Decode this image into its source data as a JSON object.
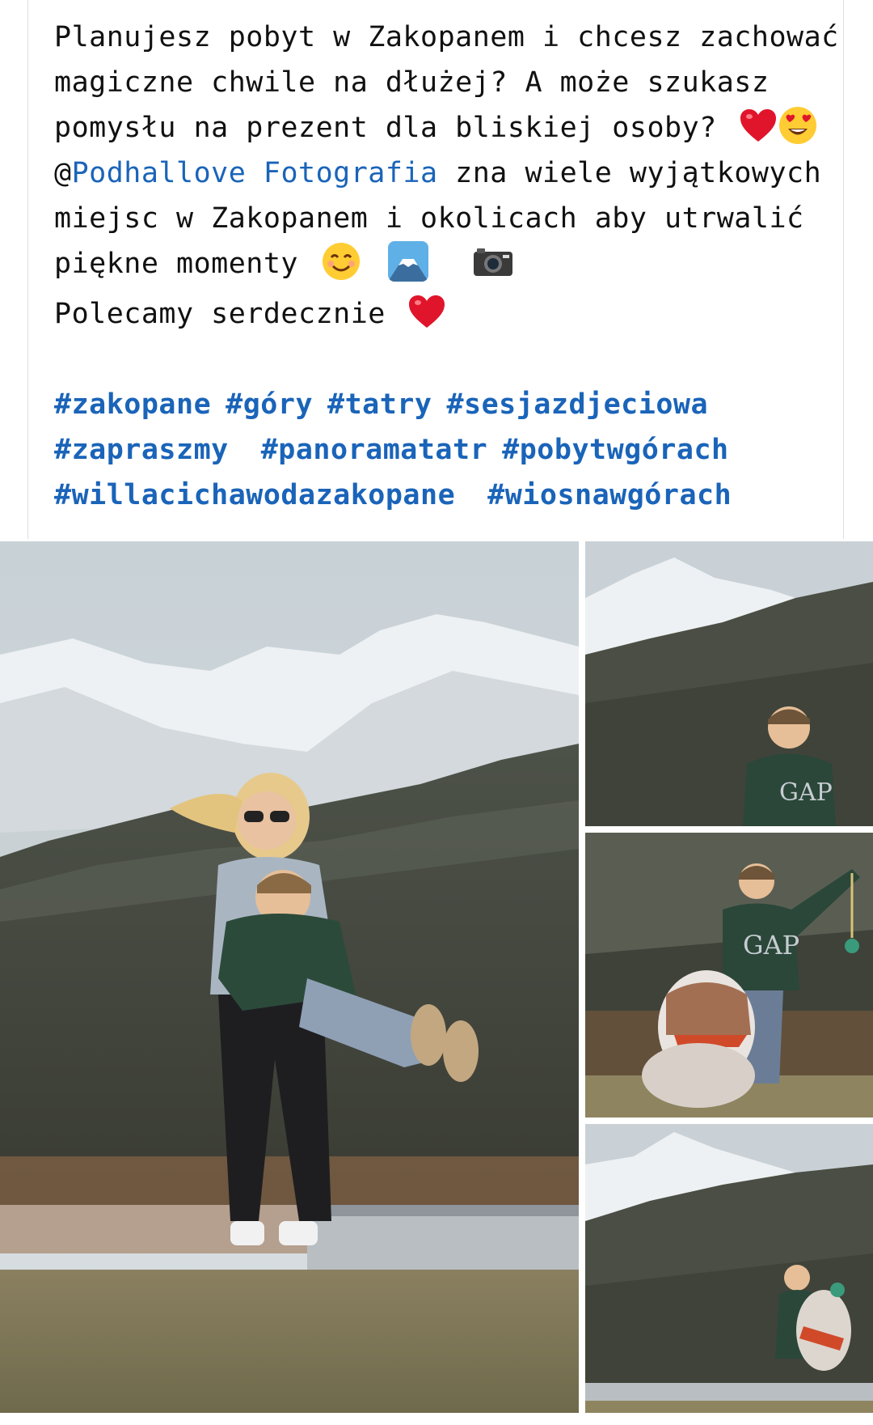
{
  "post": {
    "lines": [
      "Planujesz pobyt w Zakopanem i chcesz zachować",
      "magiczne chwile na dłużej? A może szukasz",
      "pomysłu na prezent dla bliskiej osoby?",
      "@",
      "Podhallove Fotografia",
      " zna wiele wyjątkowych",
      "miejsc w Zakopanem i okolicach aby utrwalić",
      "piękne momenty",
      "Polecamy serdecznie"
    ],
    "hashtags": [
      [
        "#zakopane",
        "#góry",
        "#tatry",
        "#sesjazdjeciowa"
      ],
      [
        "#zapraszmy",
        "#panoramatatr",
        "#pobytwgórach"
      ],
      [
        "#willacichawodazakopane",
        "#wiosnawgórach"
      ]
    ]
  },
  "icons": [
    "heart-icon",
    "heart-eyes-icon",
    "smiling-face-icon",
    "mount-fuji-icon",
    "camera-icon"
  ],
  "colors": {
    "mention": "#1a64b9",
    "hashtag": "#1a64b9",
    "text": "#111111",
    "heart": "#e0152b"
  },
  "gallery": {
    "photos": [
      "main-photo-woman-spinning-boy",
      "boy-in-gap-hoodie",
      "boy-with-dog-toy",
      "boy-with-jumping-dog"
    ]
  }
}
